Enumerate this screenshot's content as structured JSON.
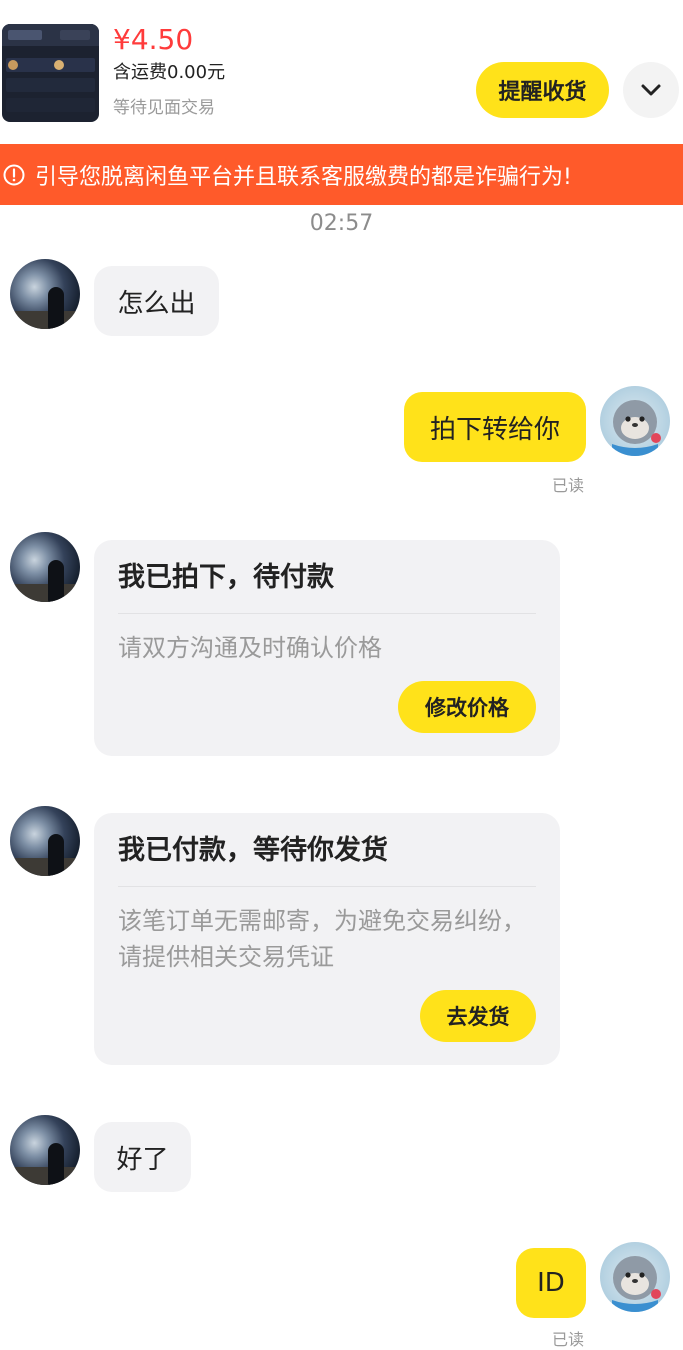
{
  "header": {
    "price": "¥4.50",
    "shipping": "含运费0.00元",
    "status": "等待见面交易",
    "remind_button": "提醒收货"
  },
  "warning": {
    "text": "引导您脱离闲鱼平台并且联系客服缴费的都是诈骗行为!"
  },
  "timestamp": "02:57",
  "messages": {
    "m1": "怎么出",
    "m2": "拍下转给你",
    "m2_read": "已读",
    "card1": {
      "title": "我已拍下，待付款",
      "desc": "请双方沟通及时确认价格",
      "button": "修改价格"
    },
    "card2": {
      "title": "我已付款，等待你发货",
      "desc": "该笔订单无需邮寄，为避免交易纠纷，请提供相关交易凭证",
      "button": "去发货"
    },
    "m3": "好了",
    "m4": "ID",
    "m4_read": "已读"
  },
  "colors": {
    "accent_yellow": "#ffe21a",
    "warning_orange": "#ff5a2a",
    "price_red": "#ff3b3b"
  }
}
